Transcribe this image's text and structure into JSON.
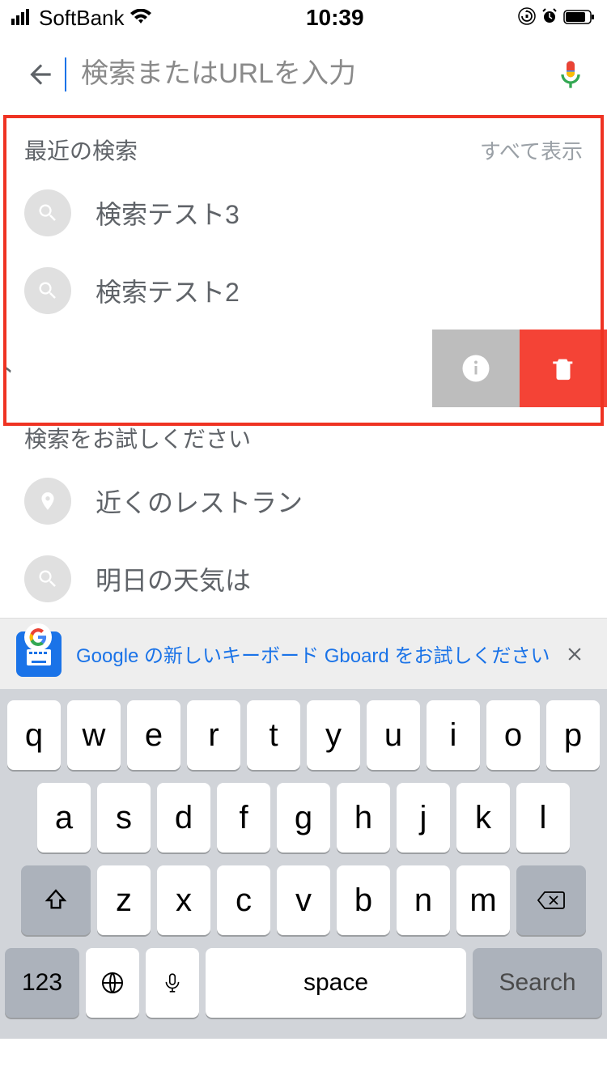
{
  "status": {
    "carrier": "SoftBank",
    "time": "10:39"
  },
  "search": {
    "placeholder": "検索またはURLを入力"
  },
  "recent": {
    "title": "最近の検索",
    "show_all": "すべて表示",
    "items": [
      {
        "label": "検索テスト3"
      },
      {
        "label": "検索テスト2"
      }
    ],
    "swiped_fragment": "ﾄ"
  },
  "suggestions": {
    "title": "検索をお試しください",
    "items": [
      {
        "label": "近くのレストラン",
        "icon": "pin"
      },
      {
        "label": "明日の天気は",
        "icon": "search"
      }
    ]
  },
  "banner": {
    "text": "Google の新しいキーボード Gboard をお試しください",
    "g_letter": "G"
  },
  "keyboard": {
    "row1": [
      "q",
      "w",
      "e",
      "r",
      "t",
      "y",
      "u",
      "i",
      "o",
      "p"
    ],
    "row2": [
      "a",
      "s",
      "d",
      "f",
      "g",
      "h",
      "j",
      "k",
      "l"
    ],
    "row3": [
      "z",
      "x",
      "c",
      "v",
      "b",
      "n",
      "m"
    ],
    "numkey": "123",
    "space": "space",
    "search": "Search"
  }
}
